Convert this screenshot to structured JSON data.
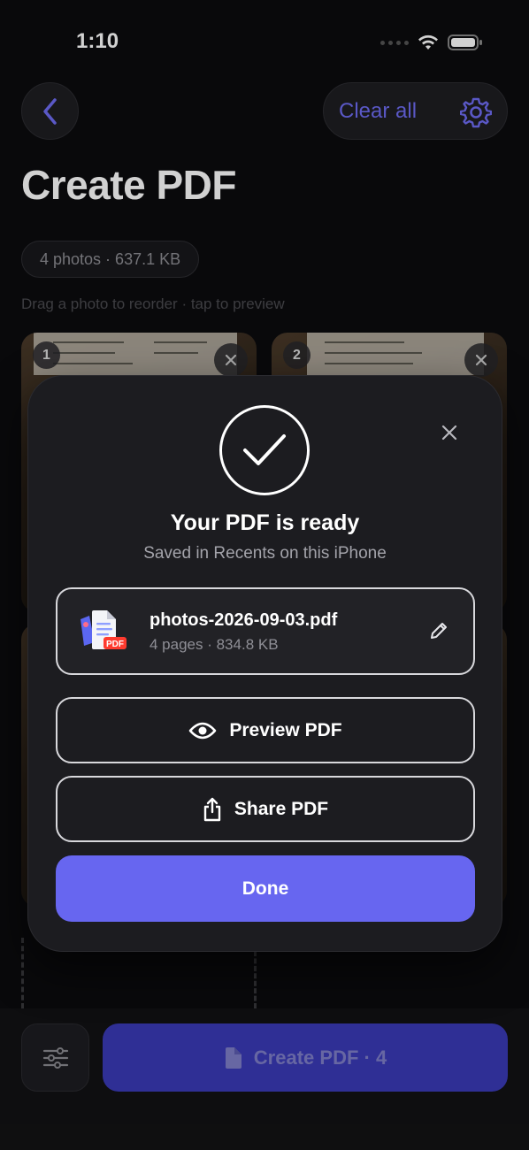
{
  "status_bar": {
    "time": "1:10"
  },
  "header": {
    "clear_all_label": "Clear all"
  },
  "page": {
    "title": "Create PDF",
    "summary_chip": "4 photos · 637.1 KB",
    "hint": "Drag a photo to reorder · tap to preview"
  },
  "photos": [
    {
      "index": "1"
    },
    {
      "index": "2"
    }
  ],
  "bottom": {
    "create_label": "Create PDF · 4"
  },
  "dialog": {
    "title": "Your PDF is ready",
    "subtitle": "Saved in Recents on this iPhone",
    "file": {
      "name": "photos-2026-09-03.pdf",
      "meta": "4 pages · 834.8 KB",
      "badge": "PDF"
    },
    "preview_label": "Preview PDF",
    "share_label": "Share PDF",
    "done_label": "Done"
  },
  "colors": {
    "accent": "#6766f0",
    "background": "#0c0c0e",
    "sheet": "#1c1c20"
  }
}
